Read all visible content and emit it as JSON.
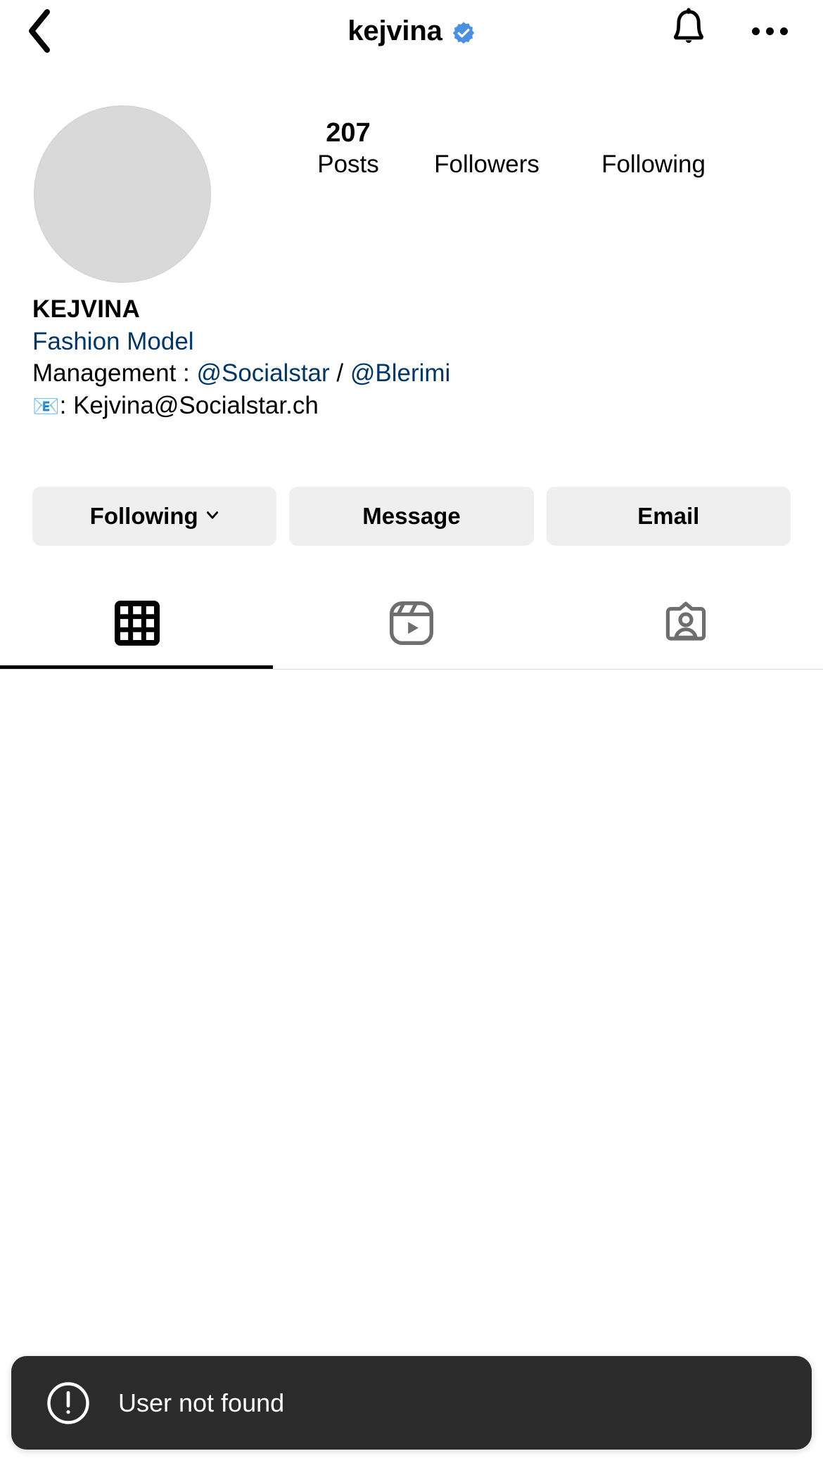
{
  "header": {
    "back_icon": "chevron-left-icon",
    "username": "kejvina",
    "verified_icon": "verified-badge-icon",
    "bell_icon": "bell-icon",
    "more_icon": "more-options-icon",
    "verified_color": "#4a90e2"
  },
  "profile": {
    "avatar_label": "",
    "avatar_color": "#d9d9d9",
    "stats": [
      {
        "value": "207",
        "label": "Posts"
      },
      {
        "value": "",
        "label": "Followers"
      },
      {
        "value": "",
        "label": "Following"
      }
    ],
    "bio": {
      "display_name": "KEJVINA",
      "category": "Fashion Model",
      "management_prefix": "Management : ",
      "management_handle_1": "@Socialstar",
      "management_separator": "  /  ",
      "management_handle_2": "@Blerimi",
      "email_emoji": "📧",
      "email_prefix": ": ",
      "email_address": "Kejvina@Socialstar.ch",
      "link_color": "#00376b"
    }
  },
  "actions": [
    {
      "label": "Following",
      "has_chevron": true,
      "icon": "chevron-down-icon"
    },
    {
      "label": "Message",
      "has_chevron": false,
      "icon": ""
    },
    {
      "label": "Email",
      "has_chevron": false,
      "icon": ""
    }
  ],
  "tabs": [
    {
      "name": "grid",
      "icon": "grid-icon",
      "active": true
    },
    {
      "name": "reels",
      "icon": "reels-icon",
      "active": false
    },
    {
      "name": "tagged",
      "icon": "tagged-icon",
      "active": false
    }
  ],
  "toast": {
    "icon": "alert-circle-icon",
    "message": "User not found",
    "background": "#2b2b2b"
  }
}
